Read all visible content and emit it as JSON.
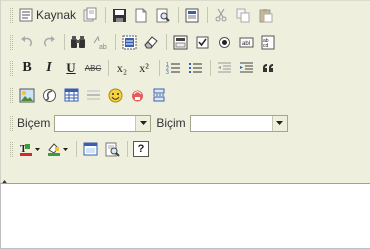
{
  "toolbar": {
    "source_label": "Kaynak",
    "format_label": "Biçem",
    "format_value": "",
    "paragraph_label": "Biçim",
    "paragraph_value": "",
    "bold_glyph": "B",
    "italic_glyph": "I",
    "underline_glyph": "U",
    "strike_glyph": "ABC",
    "subscript_glyph": "x₂",
    "superscript_glyph": "x²",
    "help_glyph": "?"
  },
  "colors": {
    "toolbar_bg": "#efefde",
    "editor_bg": "#ffffff",
    "border": "#a0a0a0"
  },
  "editor": {
    "content": ""
  }
}
